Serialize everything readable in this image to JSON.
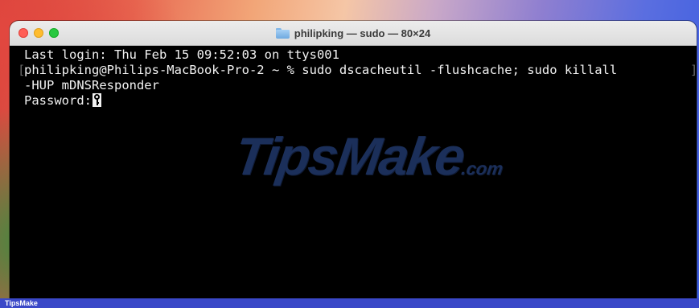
{
  "window": {
    "title": "philipking — sudo — 80×24"
  },
  "terminal": {
    "lines": [
      "Last login: Thu Feb 15 09:52:03 on ttys001",
      "philipking@Philips-MacBook-Pro-2 ~ % sudo dscacheutil -flushcache; sudo killall",
      "-HUP mDNSResponder",
      "Password:"
    ],
    "wrap_left": "[",
    "wrap_right": "]"
  },
  "watermark": {
    "main": "TipsMake",
    "suffix": ".com"
  },
  "footer": {
    "label": "TipsMake"
  },
  "icons": {
    "window_icon": "folder-icon",
    "cursor_icon": "key-icon"
  },
  "colors": {
    "close": "#ff5f57",
    "minimize": "#febc2e",
    "maximize": "#28c840",
    "terminal_bg": "#000000",
    "terminal_fg": "#f2f2f2"
  }
}
